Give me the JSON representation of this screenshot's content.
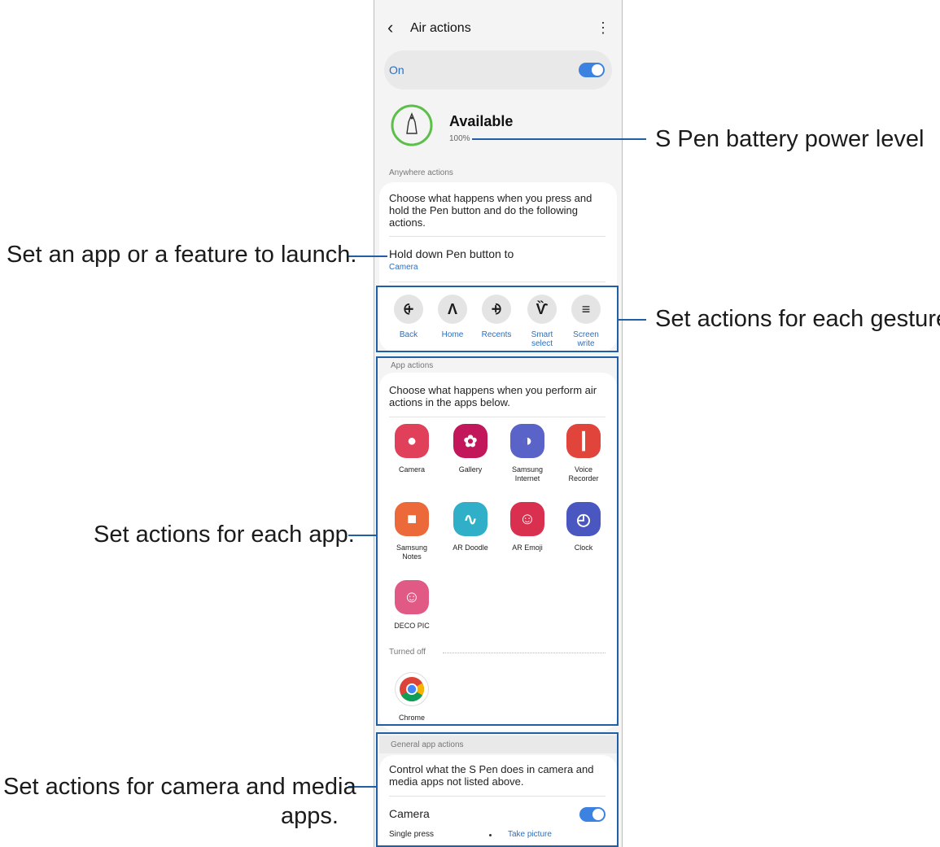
{
  "header": {
    "back_icon": "chevron-left-icon",
    "title": "Air actions",
    "more_icon": "more-vert-icon"
  },
  "master_toggle": {
    "label": "On",
    "state": "on",
    "color": "#3c82e0"
  },
  "battery": {
    "icon": "s-pen-icon",
    "status": "Available",
    "level": "100%",
    "level_value": 1.0,
    "ring_color": "#5cbf4a"
  },
  "anywhere": {
    "section_label": "Anywhere actions",
    "description": "Choose what happens when you press and hold the Pen button and do the following actions.",
    "hold_title": "Hold down Pen button to",
    "hold_value": "Camera",
    "gestures": [
      {
        "label": "Back",
        "glyph": "⨭"
      },
      {
        "label": "Home",
        "glyph": "Λ"
      },
      {
        "label": "Recents",
        "glyph": "⨮"
      },
      {
        "label": "Smart select",
        "glyph": "Ѷ"
      },
      {
        "label": "Screen write",
        "glyph": "≡"
      }
    ]
  },
  "app_actions": {
    "section_label": "App actions",
    "description": "Choose what happens when you perform air actions in the apps below.",
    "apps": [
      {
        "label": "Camera",
        "icon": "camera-icon",
        "color": "#e0405a",
        "glyph": "●"
      },
      {
        "label": "Gallery",
        "icon": "gallery-icon",
        "color": "#c2185b",
        "glyph": "✿"
      },
      {
        "label": "Samsung Internet",
        "icon": "samsung-internet-icon",
        "color": "#5a63c8",
        "glyph": "◑"
      },
      {
        "label": "Voice Recorder",
        "icon": "voice-recorder-icon",
        "color": "#e0443b",
        "glyph": "┃"
      },
      {
        "label": "Samsung Notes",
        "icon": "samsung-notes-icon",
        "color": "#ec6a3a",
        "glyph": "■"
      },
      {
        "label": "AR Doodle",
        "icon": "ar-doodle-icon",
        "color": "#2fb0c8",
        "glyph": "∿"
      },
      {
        "label": "AR Emoji",
        "icon": "ar-emoji-icon",
        "color": "#d8304e",
        "glyph": "☺"
      },
      {
        "label": "Clock",
        "icon": "clock-icon",
        "color": "#4a57c0",
        "glyph": "◴"
      },
      {
        "label": "DECO PIC",
        "icon": "deco-pic-icon",
        "color": "#e05a85",
        "glyph": "☺"
      }
    ],
    "turned_off_label": "Turned off",
    "turned_off_apps": [
      {
        "label": "Chrome",
        "icon": "chrome-icon",
        "color": "#ffffff",
        "glyph": "◉"
      }
    ]
  },
  "general": {
    "section_label": "General app actions",
    "description": "Control what the S Pen does in camera and media apps not listed above.",
    "camera_label": "Camera",
    "camera_toggle": "on",
    "single_press": "Single press",
    "single_press_value": "Take picture"
  },
  "callouts": {
    "battery": "S Pen battery power level",
    "launch": "Set an app or a feature to launch.",
    "gesture": "Set actions for each gesture.",
    "each_app": "Set actions for each app.",
    "camera_media_1": "Set actions for camera and media",
    "camera_media_2": "apps."
  },
  "accent_color": "#1f5fa5"
}
